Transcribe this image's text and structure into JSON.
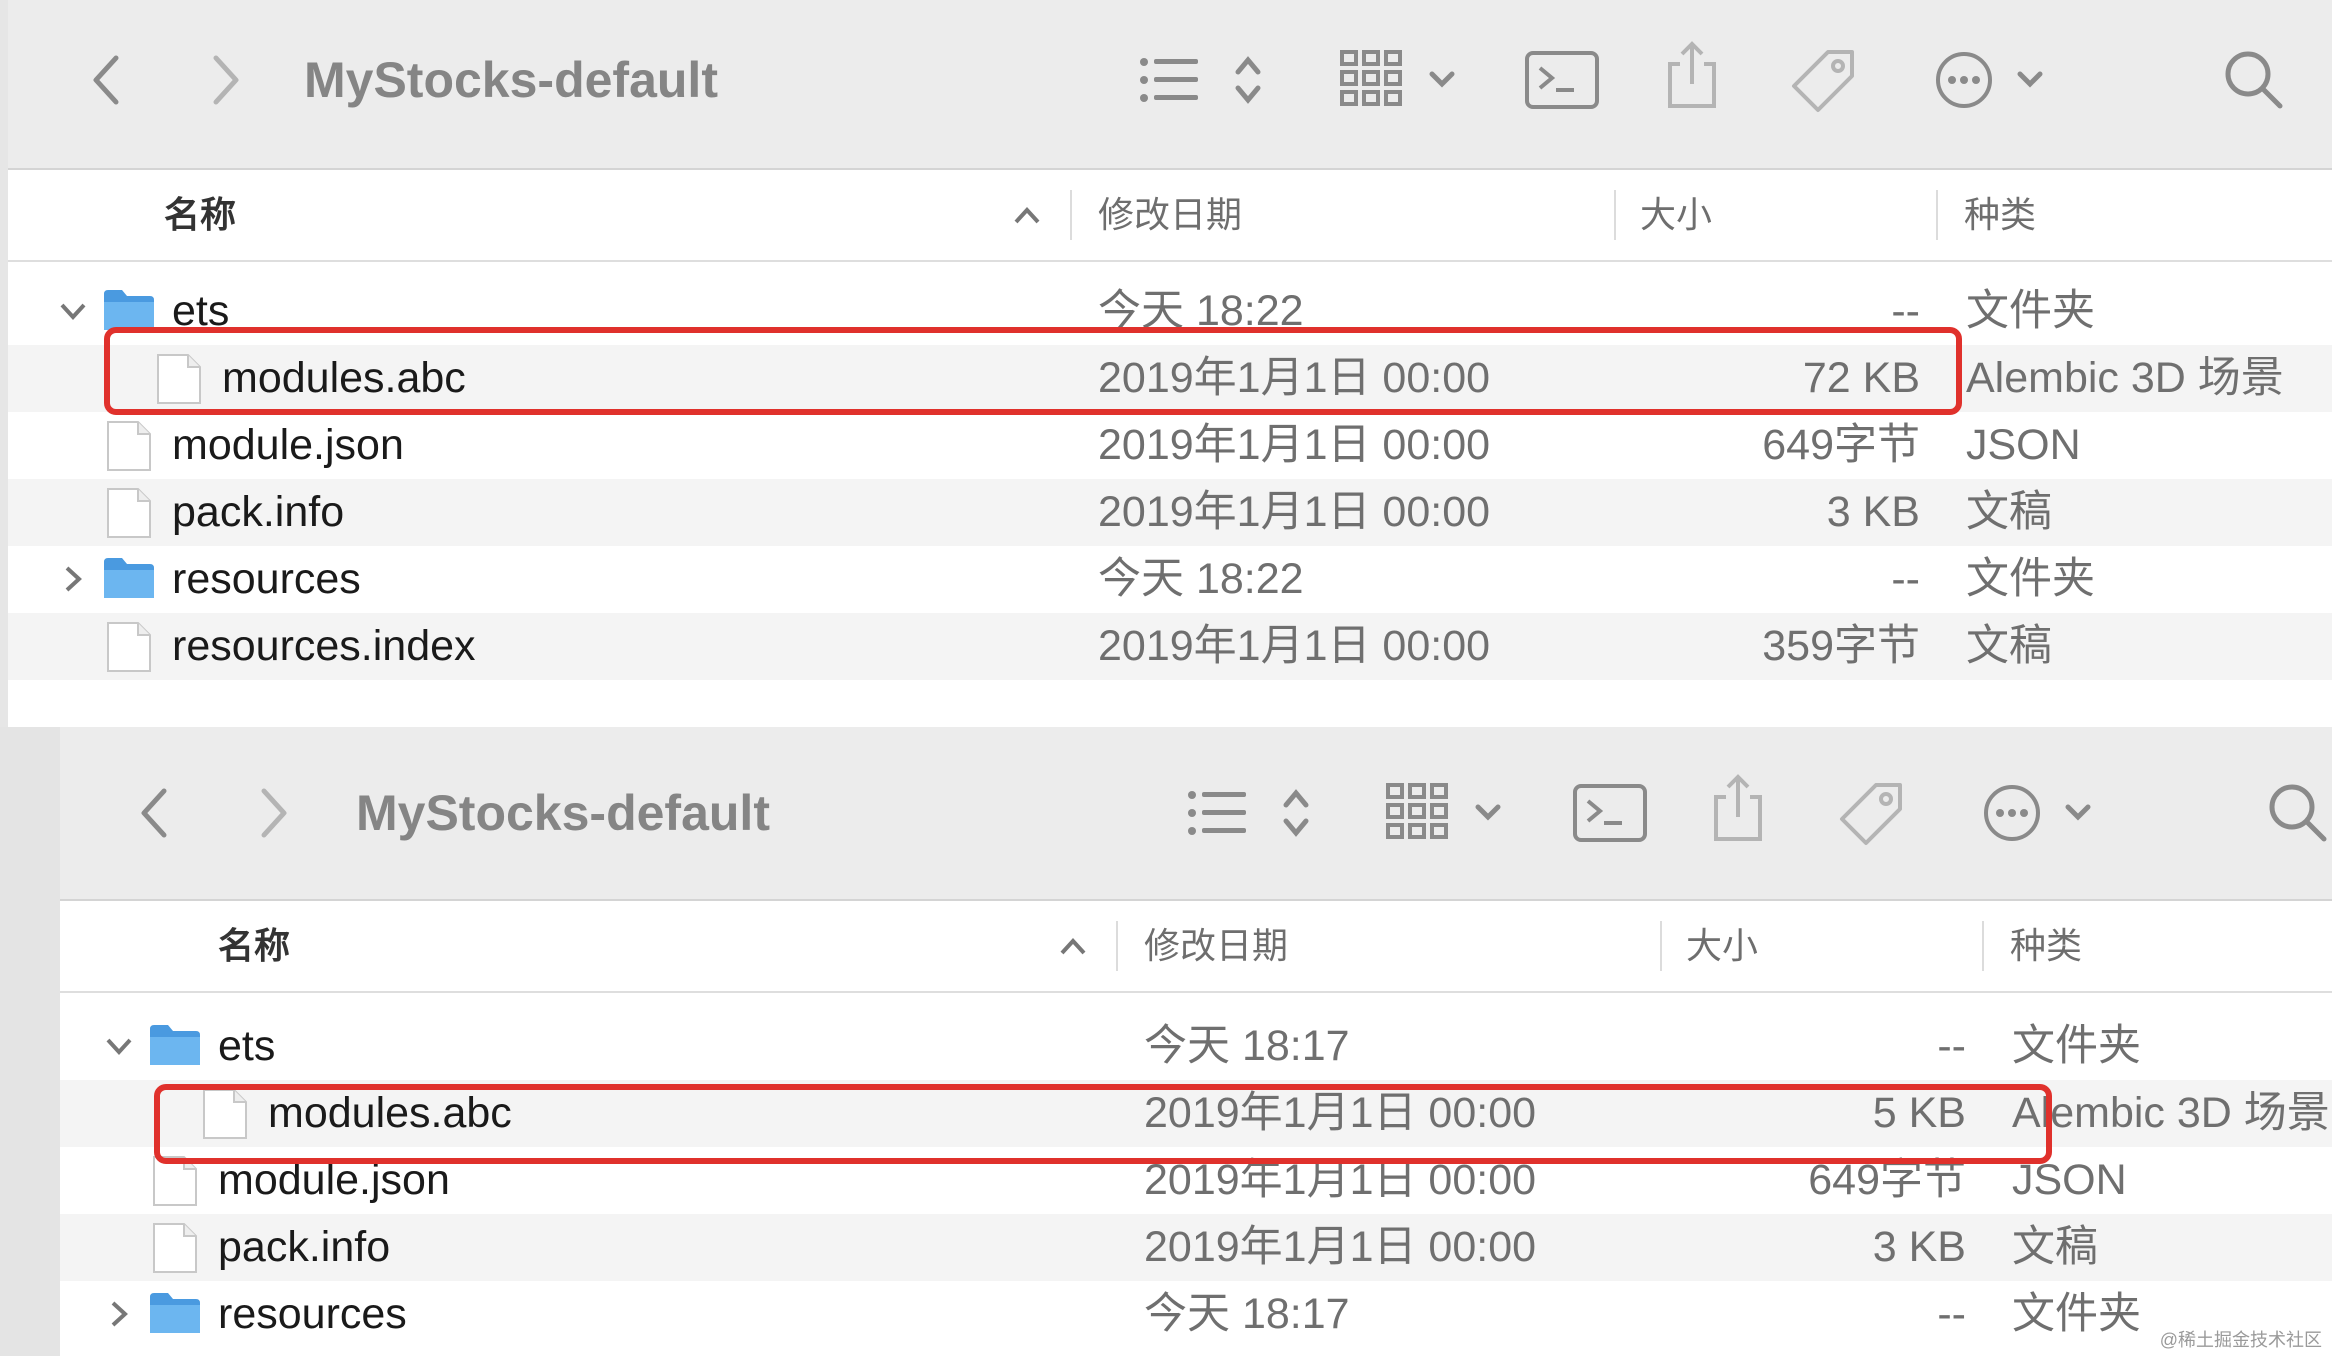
{
  "watermark": "@稀土掘金技术社区",
  "colors": {
    "highlight": "#e0312c",
    "folder": "#5aa8e8"
  },
  "windows": [
    {
      "title": "MyStocks-default",
      "columns": {
        "name": "名称",
        "modified": "修改日期",
        "size": "大小",
        "kind": "种类"
      },
      "toolbar_icons": [
        "back-icon",
        "forward-icon",
        "list-view-icon",
        "grid-view-icon",
        "terminal-icon",
        "share-icon",
        "tag-icon",
        "more-icon",
        "search-icon"
      ],
      "rows": [
        {
          "name": "ets",
          "modified": "今天 18:22",
          "size": "--",
          "kind": "文件夹",
          "type": "folder",
          "expanded": true
        },
        {
          "name": "modules.abc",
          "modified": "2019年1月1日 00:00",
          "size": "72 KB",
          "kind": "Alembic 3D 场景",
          "type": "file",
          "child": true,
          "highlighted": true
        },
        {
          "name": "module.json",
          "modified": "2019年1月1日 00:00",
          "size": "649字节",
          "kind": "JSON",
          "type": "file"
        },
        {
          "name": "pack.info",
          "modified": "2019年1月1日 00:00",
          "size": "3 KB",
          "kind": "文稿",
          "type": "file"
        },
        {
          "name": "resources",
          "modified": "今天 18:22",
          "size": "--",
          "kind": "文件夹",
          "type": "folder",
          "expanded": false
        },
        {
          "name": "resources.index",
          "modified": "2019年1月1日 00:00",
          "size": "359字节",
          "kind": "文稿",
          "type": "file"
        }
      ]
    },
    {
      "title": "MyStocks-default",
      "columns": {
        "name": "名称",
        "modified": "修改日期",
        "size": "大小",
        "kind": "种类"
      },
      "toolbar_icons": [
        "back-icon",
        "forward-icon",
        "list-view-icon",
        "grid-view-icon",
        "terminal-icon",
        "share-icon",
        "tag-icon",
        "more-icon",
        "search-icon"
      ],
      "rows": [
        {
          "name": "ets",
          "modified": "今天 18:17",
          "size": "--",
          "kind": "文件夹",
          "type": "folder",
          "expanded": true
        },
        {
          "name": "modules.abc",
          "modified": "2019年1月1日 00:00",
          "size": "5 KB",
          "kind": "Alembic 3D 场景",
          "type": "file",
          "child": true,
          "highlighted": true
        },
        {
          "name": "module.json",
          "modified": "2019年1月1日 00:00",
          "size": "649字节",
          "kind": "JSON",
          "type": "file"
        },
        {
          "name": "pack.info",
          "modified": "2019年1月1日 00:00",
          "size": "3 KB",
          "kind": "文稿",
          "type": "file"
        },
        {
          "name": "resources",
          "modified": "今天 18:17",
          "size": "--",
          "kind": "文件夹",
          "type": "folder",
          "expanded": false
        }
      ]
    }
  ]
}
